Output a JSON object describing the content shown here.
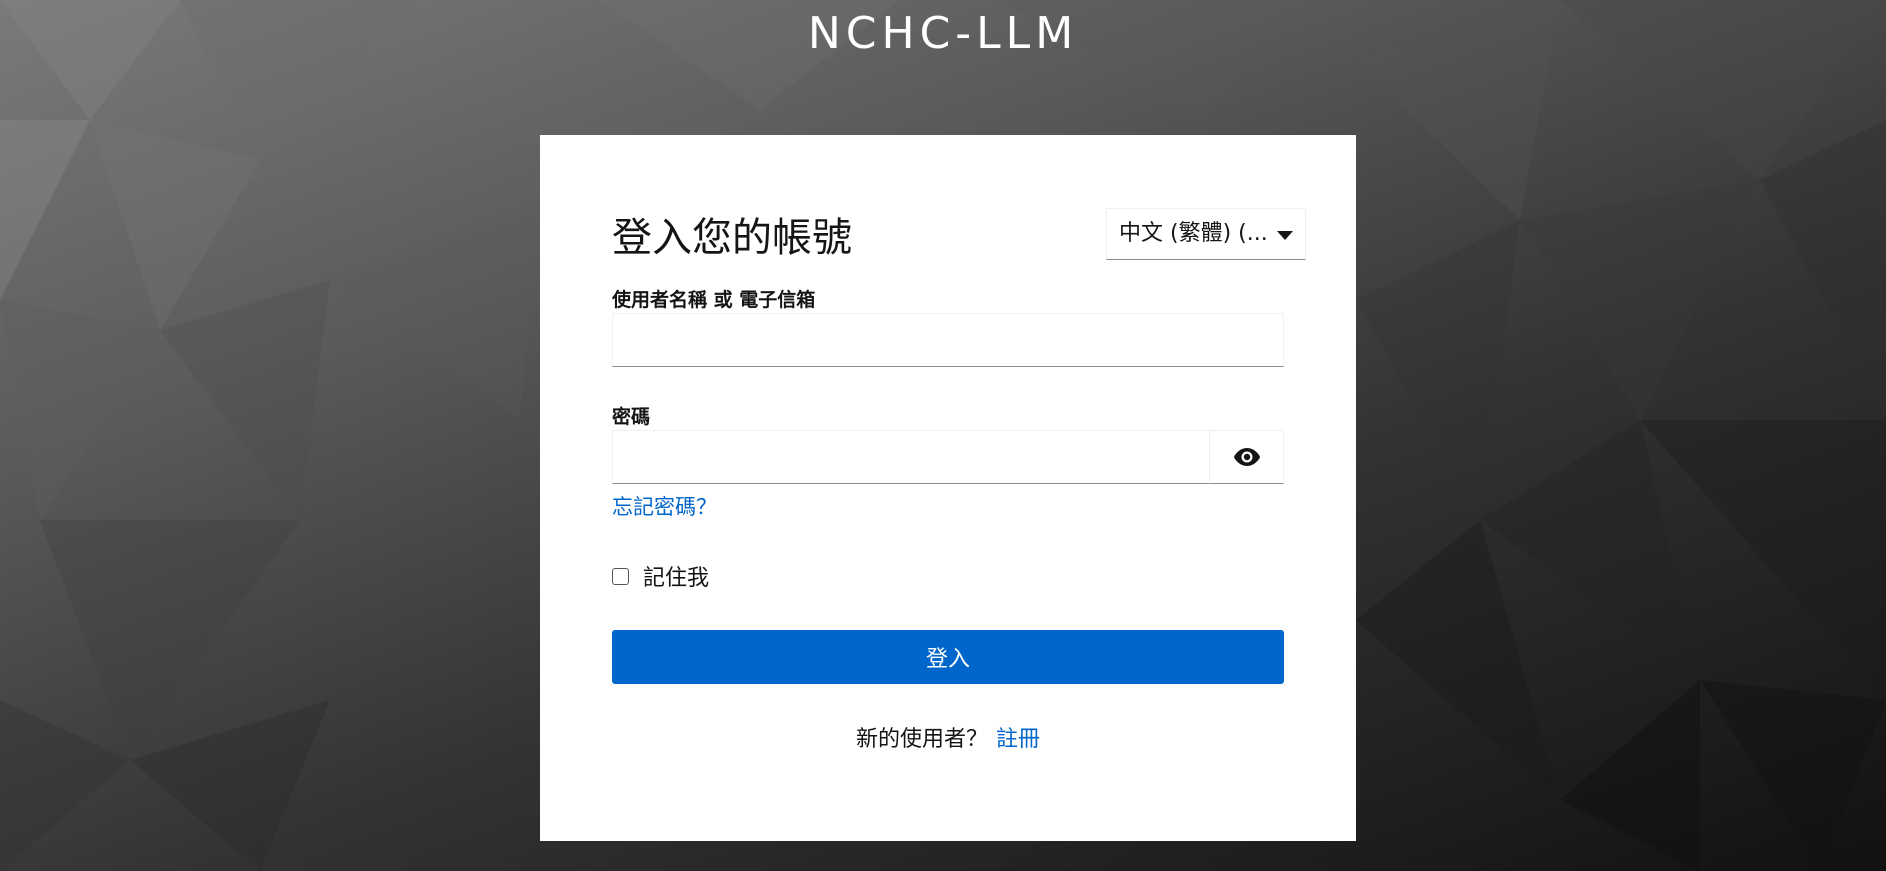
{
  "site": {
    "title": "NCHC-LLM"
  },
  "login": {
    "heading": "登入您的帳號",
    "language_selected": "中文 (繁體) (...",
    "username_label": "使用者名稱 或 電子信箱",
    "username_value": "",
    "password_label": "密碼",
    "password_value": "",
    "forgot_password": "忘記密碼？",
    "remember_me": "記住我",
    "submit_label": "登入",
    "new_user_text": "新的使用者？",
    "register_label": "註冊"
  },
  "icons": {
    "show_password": "eye-icon",
    "language_dropdown": "caret-down-icon"
  },
  "colors": {
    "primary": "#0066cc",
    "link": "#0066cc",
    "card_bg": "#ffffff",
    "text": "#151515"
  }
}
